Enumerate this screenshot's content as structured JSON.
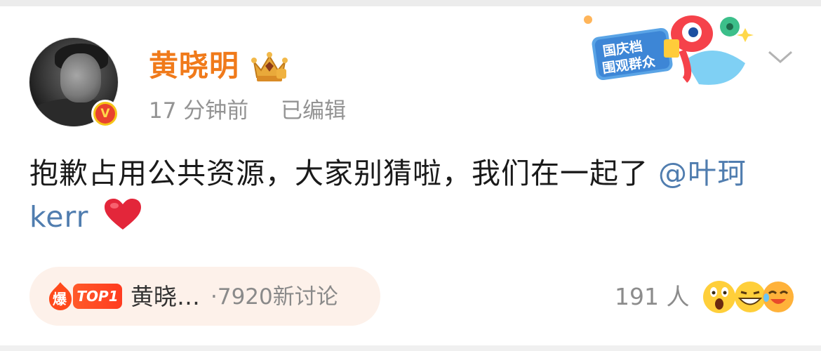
{
  "post": {
    "author": {
      "name": "黄晓明",
      "avatar_icon": "avatar-photo",
      "verified_badge": "V",
      "verified_color": "#f5c518",
      "name_color": "#f07a1a"
    },
    "meta": {
      "time": "17 分钟前",
      "edited": "已编辑"
    },
    "text": "抱歉占用公共资源，大家别猜啦，我们在一起了",
    "mention": "@叶珂 kerr",
    "mention_color": "#507daf",
    "trailing_emoji": "red-heart-icon"
  },
  "promo_sticker": {
    "line1": "国庆档",
    "line2": "围观群众"
  },
  "hot_topic": {
    "fire_glyph": "爆",
    "tag": "TOP1",
    "title": "黄晓…",
    "discussion": "·7920新讨论"
  },
  "reactions": {
    "count": "191 人",
    "emojis": [
      "shocked-face-icon",
      "grinning-squint-face-icon",
      "laughing-crying-face-icon"
    ]
  }
}
